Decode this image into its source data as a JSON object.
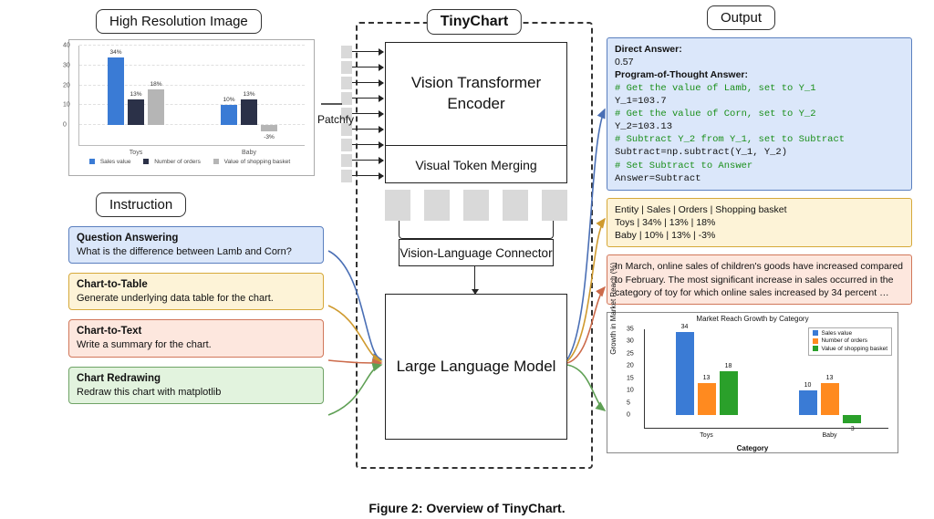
{
  "headers": {
    "image": "High Resolution Image",
    "instruction": "Instruction",
    "tinychart": "TinyChart",
    "output": "Output"
  },
  "center": {
    "patchfy": "Patchfy",
    "vit": "Vision Transformer Encoder",
    "merge": "Visual Token Merging",
    "connector": "Vision-Language Connector",
    "llm": "Large Language Model"
  },
  "instructions": {
    "qa_title": "Question Answering",
    "qa_body": "What is the difference between Lamb and Corn?",
    "c2table_title": "Chart-to-Table",
    "c2table_body": "Generate underlying data table for the chart.",
    "c2text_title": "Chart-to-Text",
    "c2text_body": "Write a summary for the chart.",
    "redraw_title": "Chart Redrawing",
    "redraw_body": "Redraw this chart with matplotlib"
  },
  "output_blue": {
    "direct_label": "Direct Answer:",
    "direct_value": "0.57",
    "pot_label": "Program-of-Thought Answer:",
    "l1": "# Get the value of Lamb, set to Y_1",
    "l2": "Y_1=103.7",
    "l3": "# Get the value of Corn, set to Y_2",
    "l4": "Y_2=103.13",
    "l5": "# Subtract Y_2 from Y_1, set to Subtract",
    "l6": "Subtract=np.subtract(Y_1, Y_2)",
    "l7": "# Set Subtract to Answer",
    "l8": "Answer=Subtract"
  },
  "output_yellow": {
    "row1": "Entity | Sales | Orders | Shopping basket",
    "row2": "Toys | 34% | 13% | 18%",
    "row3": "Baby | 10% | 13% | -3%"
  },
  "output_pink": {
    "text": "In March, online sales of children's goods have increased compared to February. The most significant increase in sales occurred in the category of toy for which online sales increased by 34 percent …"
  },
  "output_chart": {
    "title": "Market Reach Growth by Category",
    "ylabel": "Growth in Market Reach (%)",
    "xlabel": "Category",
    "legend1": "Sales value",
    "legend2": "Number of orders",
    "legend3": "Value of shopping basket"
  },
  "chart_data": {
    "input_chart": {
      "type": "bar",
      "categories": [
        "Toys",
        "Baby"
      ],
      "series": [
        {
          "name": "Sales value",
          "values": [
            34,
            10
          ],
          "color": "#3a7bd5"
        },
        {
          "name": "Number of orders",
          "values": [
            13,
            13
          ],
          "color": "#2b3148"
        },
        {
          "name": "Value of shopping basket",
          "values": [
            18,
            -3
          ],
          "color": "#b5b5b5"
        }
      ],
      "xlabel": "",
      "ylabel": "",
      "ylim": [
        -10,
        40
      ],
      "yticks": [
        0,
        10,
        20,
        30,
        40
      ]
    },
    "output_chart": {
      "type": "bar",
      "title": "Market Reach Growth by Category",
      "categories": [
        "Toys",
        "Baby"
      ],
      "series": [
        {
          "name": "Sales value",
          "values": [
            34,
            10
          ],
          "color": "#3a7bd5"
        },
        {
          "name": "Number of orders",
          "values": [
            13,
            13
          ],
          "color": "#ff8a1f"
        },
        {
          "name": "Value of shopping basket",
          "values": [
            18,
            -3
          ],
          "color": "#2aa02a"
        }
      ],
      "xlabel": "Category",
      "ylabel": "Growth in Market Reach (%)",
      "ylim": [
        -5,
        35
      ],
      "yticks": [
        0,
        5,
        10,
        15,
        20,
        25,
        30,
        35
      ]
    }
  },
  "caption": "Figure 2: Overview of TinyChart."
}
